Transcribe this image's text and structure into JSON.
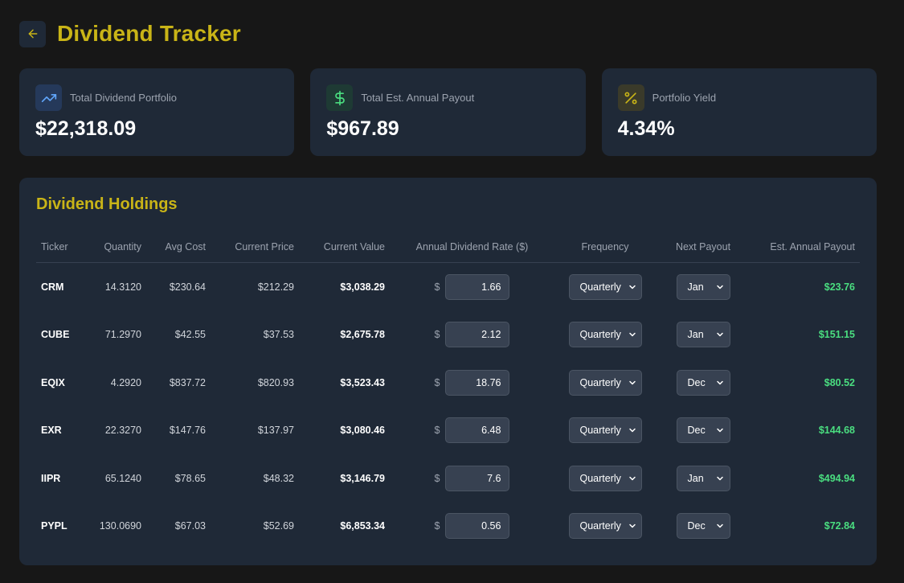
{
  "header": {
    "title": "Dividend Tracker"
  },
  "colors": {
    "accent": "#c9b417",
    "positive": "#4ade80",
    "panel": "#1f2937",
    "background": "#171717"
  },
  "cards": [
    {
      "label": "Total Dividend Portfolio",
      "value": "$22,318.09",
      "icon": "trending-up-icon"
    },
    {
      "label": "Total Est. Annual Payout",
      "value": "$967.89",
      "icon": "dollar-sign-icon"
    },
    {
      "label": "Portfolio Yield",
      "value": "4.34%",
      "icon": "percent-icon"
    }
  ],
  "holdings": {
    "title": "Dividend Holdings",
    "columns": [
      "Ticker",
      "Quantity",
      "Avg Cost",
      "Current Price",
      "Current Value",
      "Annual Dividend Rate ($)",
      "Frequency",
      "Next Payout",
      "Est. Annual Payout"
    ],
    "currency_symbol": "$",
    "rows": [
      {
        "ticker": "CRM",
        "quantity": "14.3120",
        "avg_cost": "$230.64",
        "current_price": "$212.29",
        "current_value": "$3,038.29",
        "rate": "1.66",
        "frequency": "Quarterly",
        "next_payout": "Jan",
        "est_payout": "$23.76"
      },
      {
        "ticker": "CUBE",
        "quantity": "71.2970",
        "avg_cost": "$42.55",
        "current_price": "$37.53",
        "current_value": "$2,675.78",
        "rate": "2.12",
        "frequency": "Quarterly",
        "next_payout": "Jan",
        "est_payout": "$151.15"
      },
      {
        "ticker": "EQIX",
        "quantity": "4.2920",
        "avg_cost": "$837.72",
        "current_price": "$820.93",
        "current_value": "$3,523.43",
        "rate": "18.76",
        "frequency": "Quarterly",
        "next_payout": "Dec",
        "est_payout": "$80.52"
      },
      {
        "ticker": "EXR",
        "quantity": "22.3270",
        "avg_cost": "$147.76",
        "current_price": "$137.97",
        "current_value": "$3,080.46",
        "rate": "6.48",
        "frequency": "Quarterly",
        "next_payout": "Dec",
        "est_payout": "$144.68"
      },
      {
        "ticker": "IIPR",
        "quantity": "65.1240",
        "avg_cost": "$78.65",
        "current_price": "$48.32",
        "current_value": "$3,146.79",
        "rate": "7.6",
        "frequency": "Quarterly",
        "next_payout": "Jan",
        "est_payout": "$494.94"
      },
      {
        "ticker": "PYPL",
        "quantity": "130.0690",
        "avg_cost": "$67.03",
        "current_price": "$52.69",
        "current_value": "$6,853.34",
        "rate": "0.56",
        "frequency": "Quarterly",
        "next_payout": "Dec",
        "est_payout": "$72.84"
      }
    ]
  }
}
